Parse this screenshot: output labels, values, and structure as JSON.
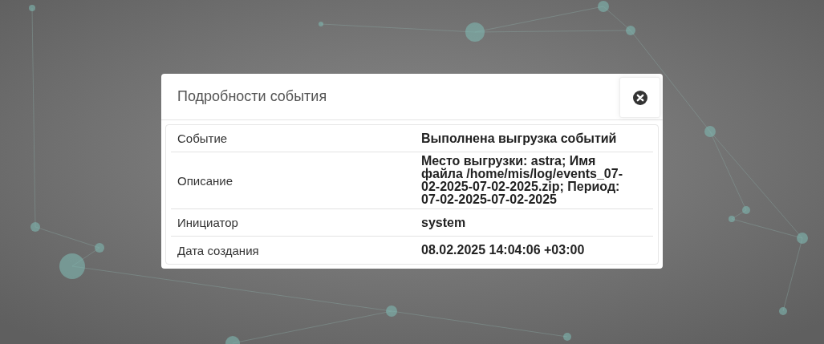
{
  "dialog": {
    "title": "Подробности события",
    "rows": [
      {
        "label": "Событие",
        "value": "Выполнена выгрузка событий"
      },
      {
        "label": "Описание",
        "value": "Место выгрузки: astra; Имя файла /home/mis/log/events_07-02-2025-07-02-2025.zip; Период: 07-02-2025-07-02-2025"
      },
      {
        "label": "Инициатор",
        "value": "system"
      },
      {
        "label": "Дата создания",
        "value": "08.02.2025 14:04:06 +03:00"
      }
    ]
  }
}
